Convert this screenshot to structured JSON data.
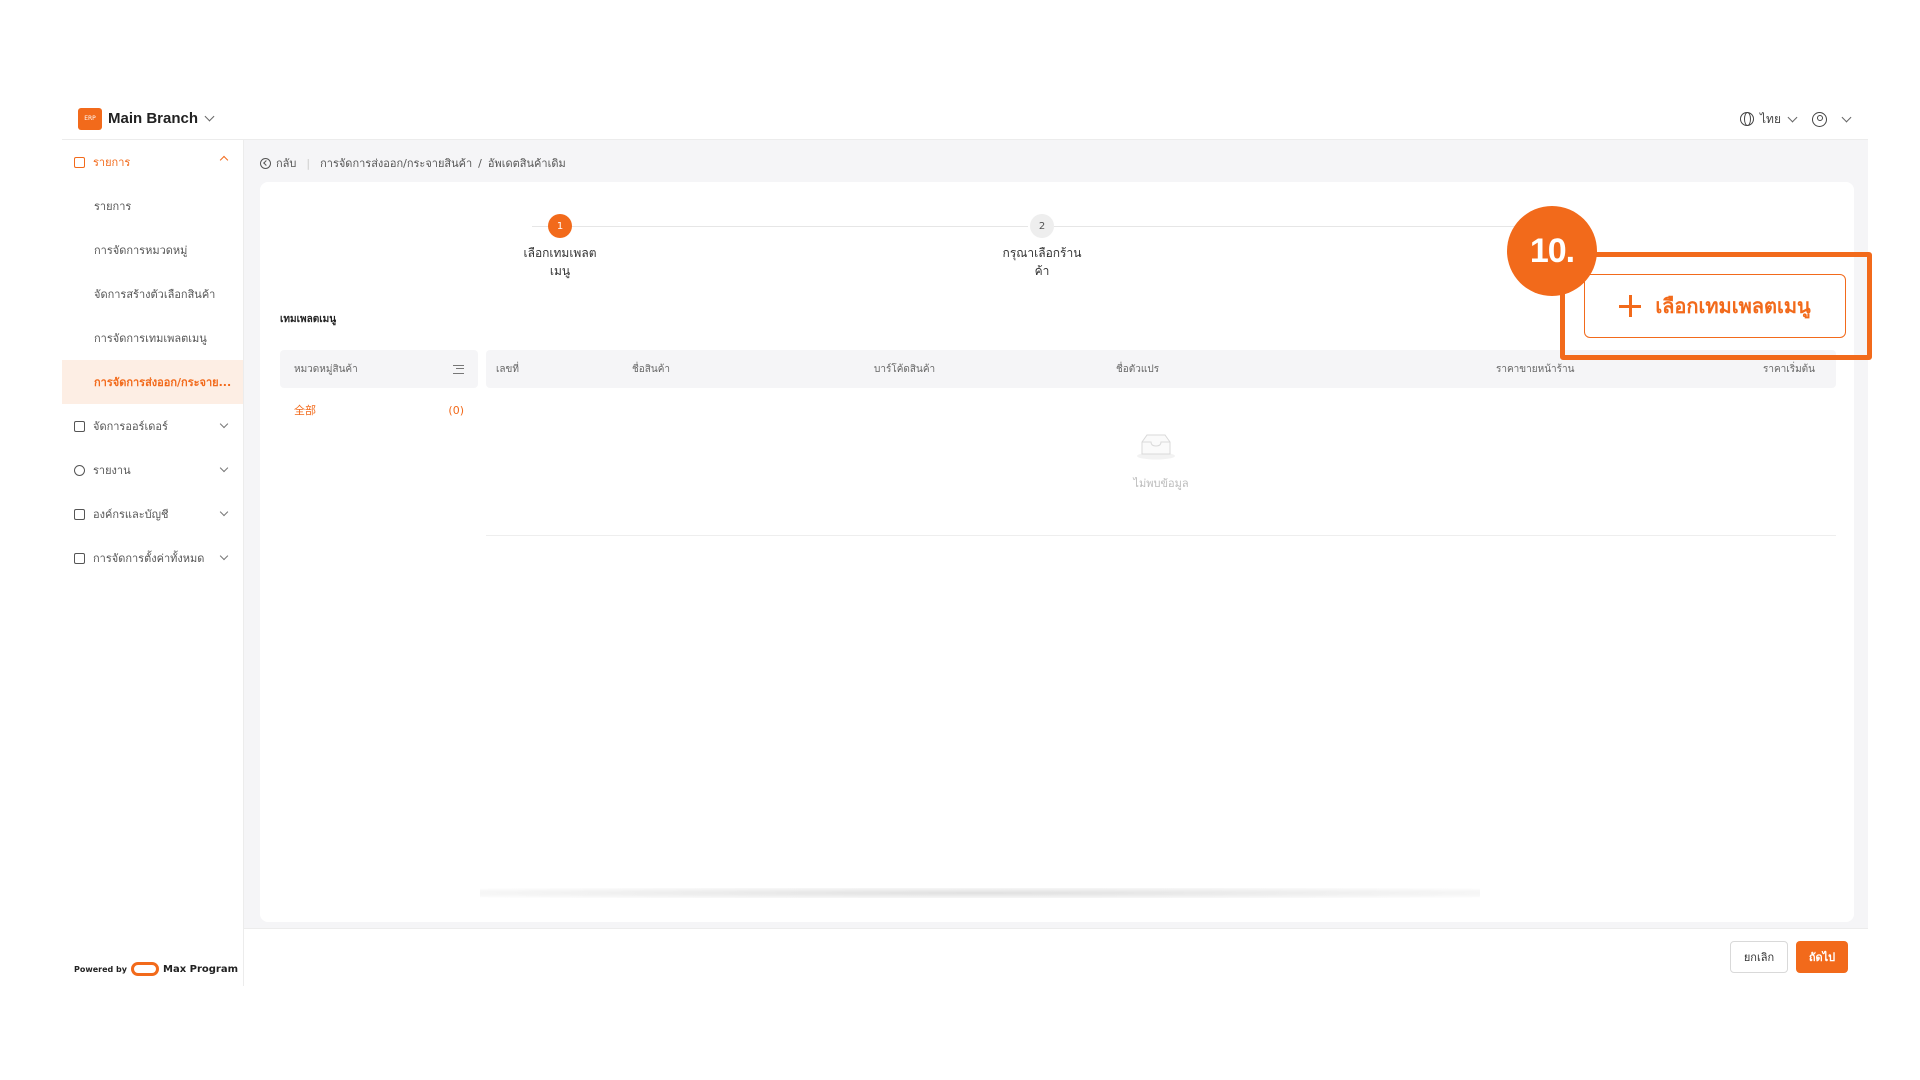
{
  "colors": {
    "accent": "#f26a1b",
    "selected_bg": "#fdeee4"
  },
  "header": {
    "logo_text": "ERP",
    "branch": "Main Branch",
    "language": "ไทย"
  },
  "sidebar": {
    "groups": [
      {
        "label": "รายการ",
        "icon": "list-icon",
        "expanded": true,
        "items": [
          {
            "label": "รายการ"
          },
          {
            "label": "การจัดการหมวดหมู่"
          },
          {
            "label": "จัดการสร้างตัวเลือกสินค้า"
          },
          {
            "label": "การจัดการเทมเพลตเมนู"
          },
          {
            "label": "การจัดการส่งออก/กระจาย...",
            "selected": true
          }
        ]
      },
      {
        "label": "จัดการออร์เดอร์",
        "icon": "clipboard-icon"
      },
      {
        "label": "รายงาน",
        "icon": "clock-icon"
      },
      {
        "label": "องค์กรและบัญชี",
        "icon": "users-icon"
      },
      {
        "label": "การจัดการตั้งค่าทั้งหมด",
        "icon": "settings-icon"
      }
    ],
    "powered_by": "Powered by",
    "program_name": "Max Program"
  },
  "breadcrumb": {
    "back": "กลับ",
    "path": [
      "การจัดการส่งออก/กระจายสินค้า",
      "อัพเดตสินค้าเดิม"
    ]
  },
  "steps": [
    {
      "number": "1",
      "line1": "เลือกเทมเพลต",
      "line2": "เมนู",
      "active": true
    },
    {
      "number": "2",
      "line1": "กรุณาเลือกร้าน",
      "line2": "ค้า",
      "active": false
    }
  ],
  "section_title": "เทมเพลตเมนู",
  "category_panel": {
    "header": "หมวดหมู่สินค้า",
    "rows": [
      {
        "label": "全部",
        "count": "(0)"
      }
    ]
  },
  "table": {
    "columns": [
      "เลขที่",
      "ชื่อสินค้า",
      "บาร์โค้ดสินค้า",
      "ชื่อตัวแปร",
      "ราคาขายหน้าร้าน",
      "ราคาเริ่มต้น"
    ],
    "empty_text": "ไม่พบข้อมูล"
  },
  "footer": {
    "cancel": "ยกเลิก",
    "next": "ถัดไป"
  },
  "tutorial": {
    "step_badge": "10.",
    "button_label": "เลือกเทมเพลตเมนู"
  }
}
